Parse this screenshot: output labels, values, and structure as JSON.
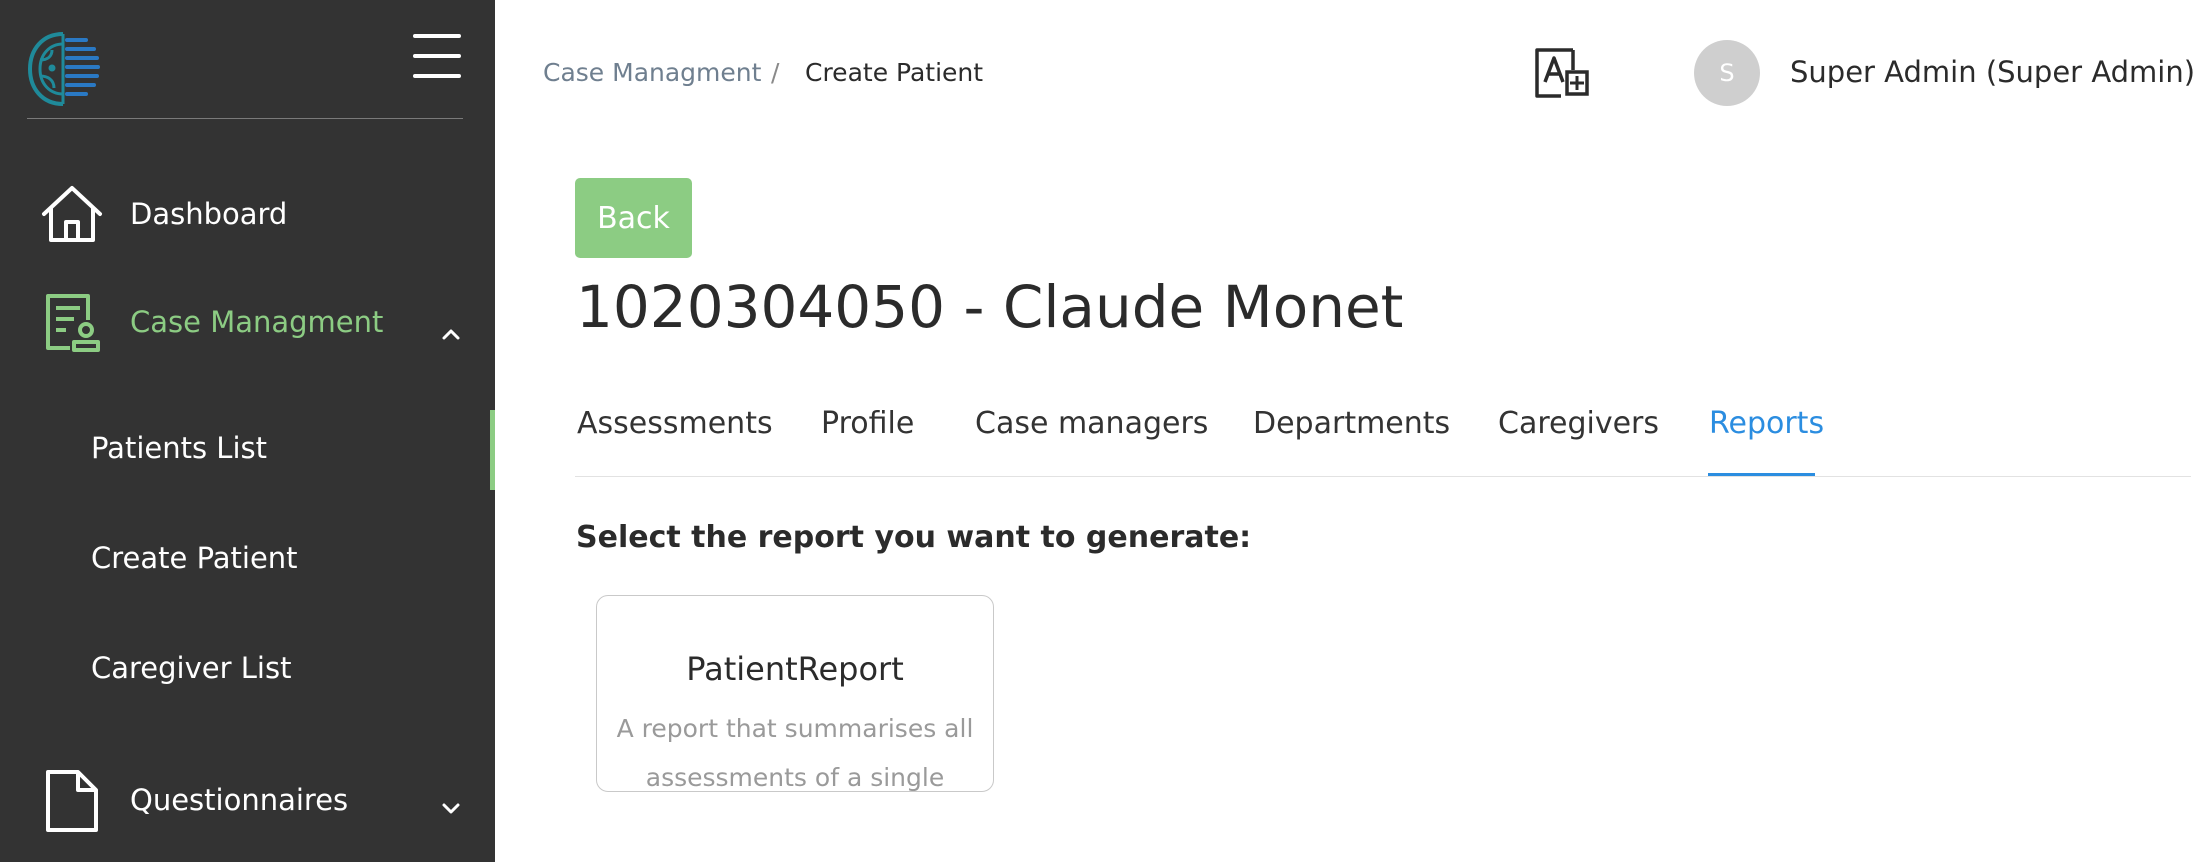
{
  "sidebar": {
    "items": [
      {
        "label": "Dashboard",
        "icon": "home-icon"
      },
      {
        "label": "Case Managment",
        "icon": "case-file-icon",
        "expanded": true,
        "children": [
          {
            "label": "Patients List",
            "active": true
          },
          {
            "label": "Create Patient"
          },
          {
            "label": "Caregiver List"
          }
        ]
      },
      {
        "label": "Questionnaires",
        "icon": "document-icon",
        "expanded": false
      }
    ]
  },
  "header": {
    "breadcrumb": {
      "parent": "Case Managment",
      "separator": "/",
      "current": "Create Patient"
    },
    "avatar_initial": "S",
    "user_name": "Super Admin (Super Admin)"
  },
  "main": {
    "back_label": "Back",
    "title": "1020304050 - Claude Monet",
    "tabs": [
      {
        "label": "Assessments"
      },
      {
        "label": "Profile"
      },
      {
        "label": "Case managers"
      },
      {
        "label": "Departments"
      },
      {
        "label": "Caregivers"
      },
      {
        "label": "Reports",
        "active": true
      }
    ],
    "prompt": "Select the report you want to generate:",
    "reports": [
      {
        "title": "PatientReport",
        "description": "A report that summarises all assessments of a single patient"
      }
    ]
  },
  "colors": {
    "sidebar_bg": "#333333",
    "accent_green": "#8ccc83",
    "active_tab_blue": "#2b8de0",
    "logo_teal": "#1f8a9a",
    "logo_blue": "#2a79c4"
  }
}
